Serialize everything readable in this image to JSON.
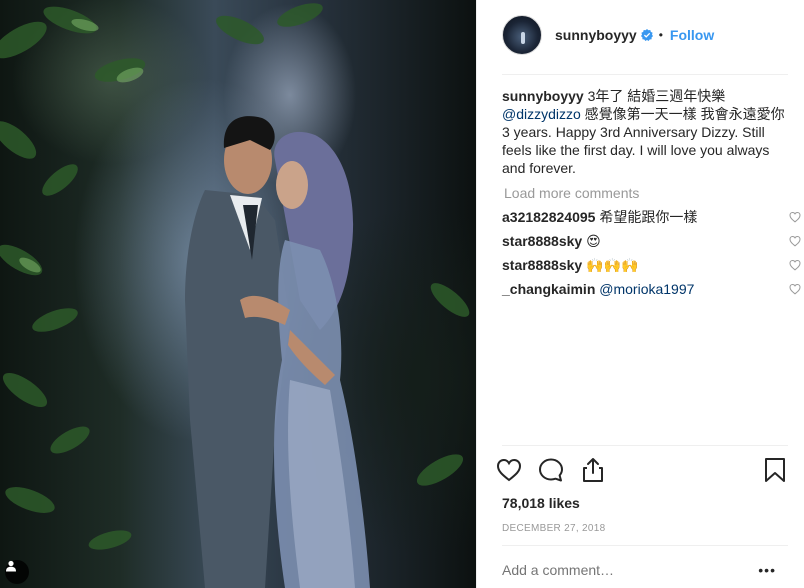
{
  "post": {
    "username": "sunnyboyyy",
    "follow_label": "Follow",
    "separator": "•",
    "caption_line1": "3年了 結婚三週年快樂",
    "caption_mention": "@dizzydizzo",
    "caption_line2": " 感覺像第一天一樣 我會永遠愛你",
    "caption_english": "3 years. Happy 3rd Anniversary Dizzy. Still feels like the first day. I will love you always and forever.",
    "load_more": "Load more comments",
    "comments": [
      {
        "user": "a32182824095",
        "text": "希望能跟你一樣"
      },
      {
        "user": "star8888sky",
        "text": "😍"
      },
      {
        "user": "star8888sky",
        "text": "🙌🙌🙌"
      },
      {
        "user": "_changkaimin",
        "text": "@morioka1997"
      }
    ],
    "likes": "78,018 likes",
    "date": "DECEMBER 27, 2018",
    "add_comment_placeholder": "Add a comment…",
    "more_label": "•••"
  },
  "icons": {
    "verified": "verified-badge-icon",
    "like": "heart-icon",
    "comment": "comment-bubble-icon",
    "share": "share-icon",
    "save": "bookmark-icon",
    "user_tag": "user-tag-icon"
  },
  "colors": {
    "accent": "#3897f0",
    "mention": "#003569",
    "muted": "#999999",
    "text": "#262626"
  }
}
